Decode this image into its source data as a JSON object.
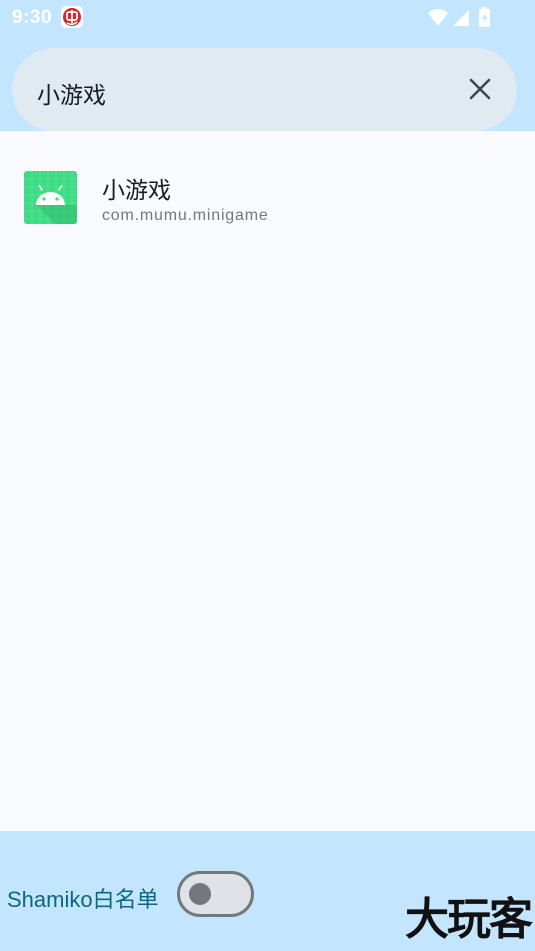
{
  "status_bar": {
    "time": "9:30",
    "app_icon": "red-circle-app-icon",
    "icons": [
      "wifi-icon",
      "cell-signal-icon",
      "battery-charging-icon"
    ]
  },
  "search": {
    "query": "小游戏",
    "clear_icon": "close-icon"
  },
  "results": [
    {
      "icon": "android-icon",
      "name": "小游戏",
      "package": "com.mumu.minigame"
    }
  ],
  "footer": {
    "whitelist_label": "Shamiko白名单",
    "whitelist_enabled": false,
    "watermark": "大玩客"
  },
  "colors": {
    "header_bg": "#c3e5fd",
    "search_bg": "#dfeaf3",
    "list_bg": "#f9fafe",
    "accent_text": "#0c6780",
    "android_green": "#3ddc84"
  }
}
